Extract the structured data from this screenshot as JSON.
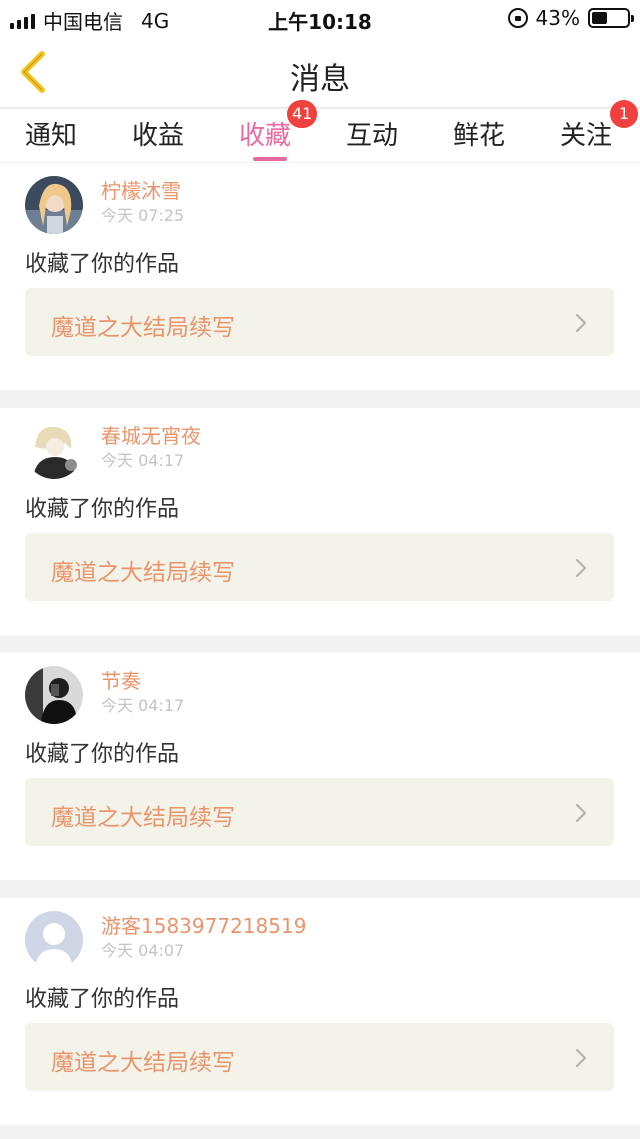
{
  "status_bar": {
    "carrier": "中国电信",
    "network": "4G",
    "time": "上午10:18",
    "battery_text": "43%",
    "battery_level": 0.43
  },
  "nav": {
    "title": "消息",
    "back_icon": "chevron-left-icon"
  },
  "tabs": [
    {
      "label": "通知",
      "badge": ""
    },
    {
      "label": "收益",
      "badge": ""
    },
    {
      "label": "收藏",
      "badge": "41",
      "active": true
    },
    {
      "label": "互动",
      "badge": ""
    },
    {
      "label": "鲜花",
      "badge": ""
    },
    {
      "label": "关注",
      "badge": "1"
    }
  ],
  "messages": [
    {
      "username": "柠檬沐雪",
      "time": "今天 07:25",
      "action": "收藏了你的作品",
      "work_title": "魔道之大结局续写"
    },
    {
      "username": "春城无宵夜",
      "time": "今天 04:17",
      "action": "收藏了你的作品",
      "work_title": "魔道之大结局续写"
    },
    {
      "username": "节奏",
      "time": "今天 04:17",
      "action": "收藏了你的作品",
      "work_title": "魔道之大结局续写"
    },
    {
      "username": "游客1583977218519",
      "time": "今天 04:07",
      "action": "收藏了你的作品",
      "work_title": "魔道之大结局续写"
    }
  ],
  "colors": {
    "accent_pink": "#e86aa1",
    "username_orange": "#e9946b",
    "badge_red": "#f0413f",
    "back_icon_yellow": "#f3c521"
  }
}
